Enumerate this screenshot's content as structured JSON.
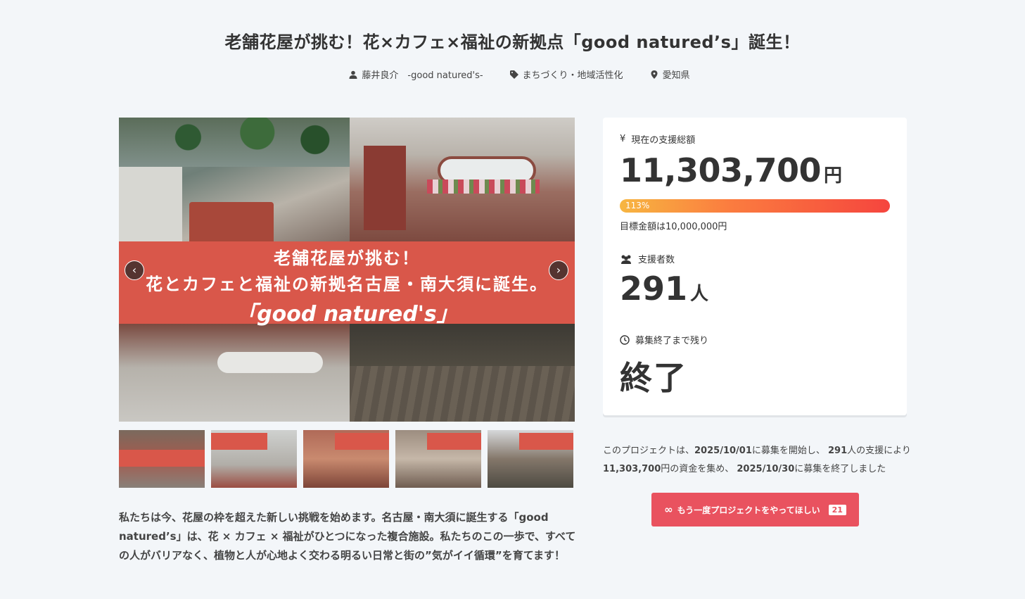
{
  "header": {
    "title": "老舗花屋が挑む！花×カフェ×福祉の新拠点「good natured’s」誕生！",
    "owner": "藤井良介　-good natured's-",
    "category": "まちづくり・地域活性化",
    "location": "愛知県"
  },
  "hero": {
    "banner_line1": "老舗花屋が挑む！",
    "banner_line2": "花とカフェと福祉の新拠名古屋・南大須に誕生。",
    "banner_line3": "「good natured's」",
    "prev_label": "‹",
    "next_label": "›"
  },
  "thumbnails": [
    {
      "id": "t1"
    },
    {
      "id": "t2"
    },
    {
      "id": "t3"
    },
    {
      "id": "t4"
    },
    {
      "id": "t5"
    }
  ],
  "description": "私たちは今、花屋の枠を超えた新しい挑戦を始めます。名古屋・南大須に誕生する「good natured’s」は、花 × カフェ × 福祉がひとつになった複合施設。私たちのこの一歩で、すべての人がバリアなく、植物と人が心地よく交わる明るい日常と街の”気がイイ循環”を育てます！",
  "stats": {
    "total_label": "現在の支援総額",
    "total_amount": "11,303,700",
    "currency_unit": "円",
    "progress_percent": 113,
    "progress_label": "113%",
    "goal_text": "目標金額は10,000,000円",
    "backers_label": "支援者数",
    "backers_count": "291",
    "backers_unit": "人",
    "remaining_label": "募集終了まで残り",
    "remaining_value": "終了"
  },
  "summary": {
    "part1": "このプロジェクトは、",
    "start_date": "2025/10/01",
    "part2": "に募集を開始し、 ",
    "backers": "291",
    "part3": "人の支援により ",
    "amount": "11,303,700",
    "part4": "円の資金を集め、 ",
    "end_date": "2025/10/30",
    "part5": "に募集を終了しました"
  },
  "again_button": {
    "label": "もう一度プロジェクトをやってほしい",
    "count": "21"
  },
  "colors": {
    "accent": "#e9525f",
    "banner": "#d9574a",
    "background": "#f3f6f9"
  }
}
